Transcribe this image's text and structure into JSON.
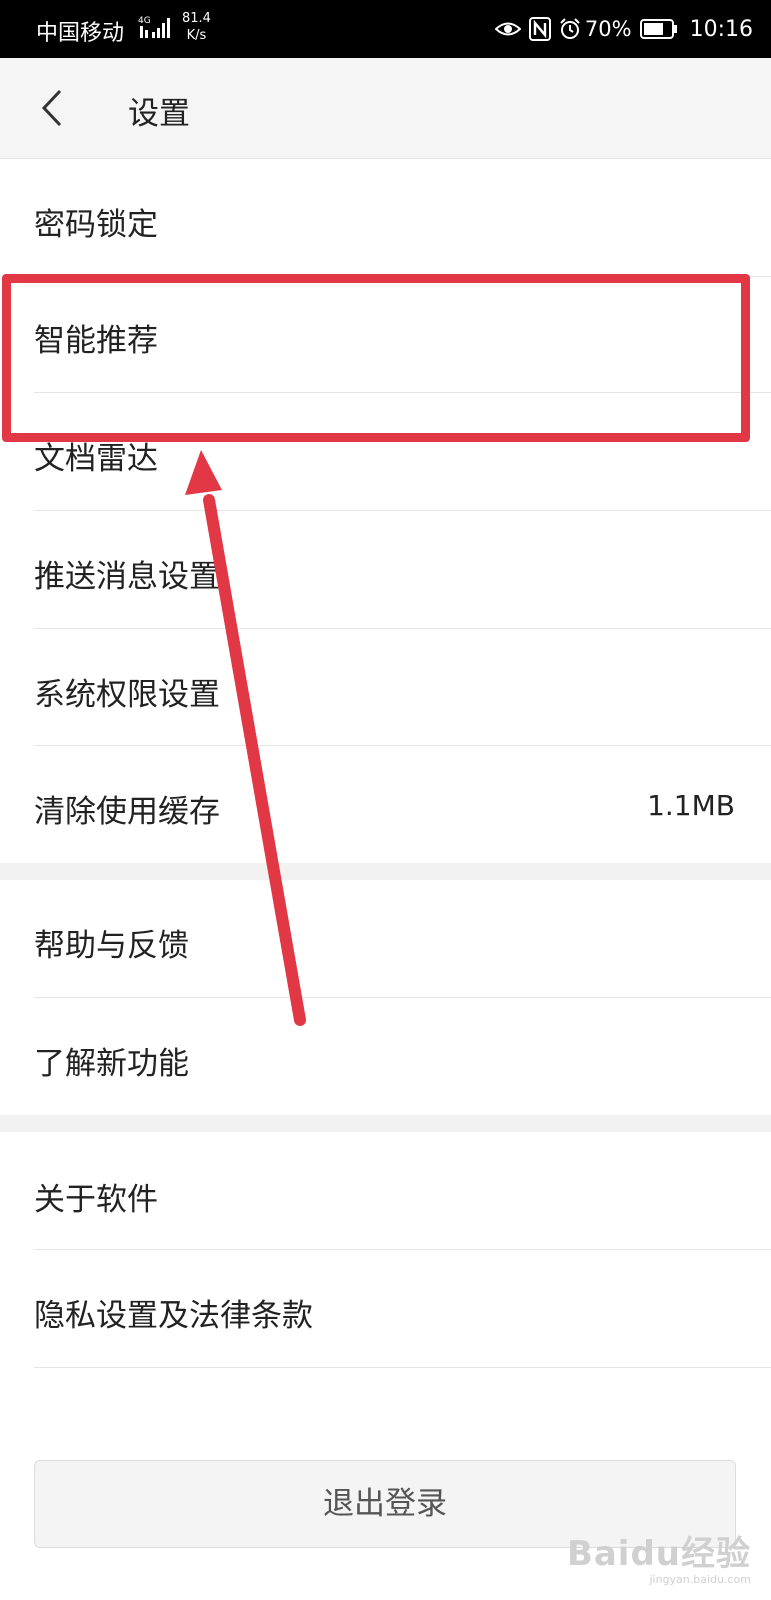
{
  "status_bar": {
    "carrier": "中国移动",
    "network": "4G",
    "speed_value": "81.4",
    "speed_unit": "K/s",
    "battery_percent": "70%",
    "time": "10:16"
  },
  "header": {
    "title": "设置"
  },
  "settings": {
    "group1": [
      {
        "label": "密码锁定"
      },
      {
        "label": "智能推荐"
      },
      {
        "label": "文档雷达"
      },
      {
        "label": "推送消息设置"
      },
      {
        "label": "系统权限设置"
      },
      {
        "label": "清除使用缓存",
        "value": "1.1MB"
      }
    ],
    "group2": [
      {
        "label": "帮助与反馈"
      },
      {
        "label": "了解新功能"
      }
    ],
    "group3": [
      {
        "label": "关于软件"
      },
      {
        "label": "隐私设置及法律条款"
      }
    ]
  },
  "logout_button": "退出登录",
  "annotation": {
    "color": "#e23744"
  },
  "watermark": {
    "logo": "Baidu经验",
    "url": "jingyan.baidu.com"
  }
}
